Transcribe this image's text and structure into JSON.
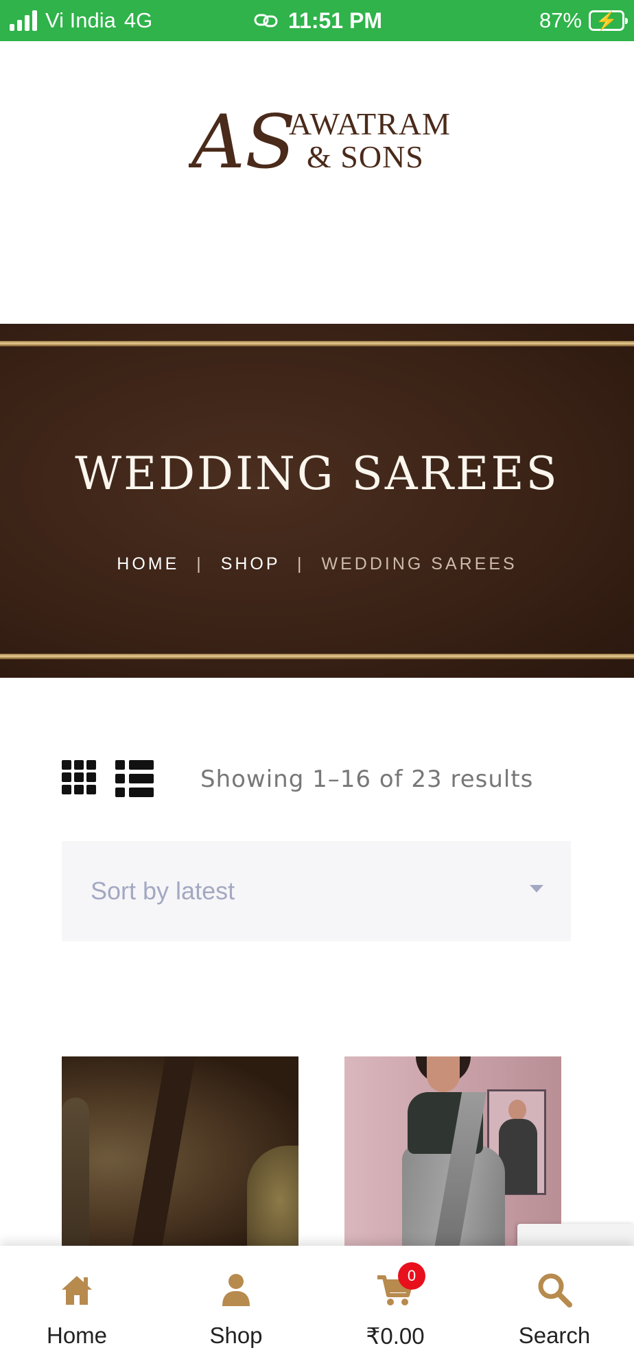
{
  "status_bar": {
    "carrier": "Vi India",
    "network": "4G",
    "time": "11:51 PM",
    "battery": "87%",
    "background_color": "#2fb34a"
  },
  "logo": {
    "monogram": "AS",
    "line1": "AWATRAM",
    "line2": "& SONS",
    "color": "#4a2a1a"
  },
  "banner": {
    "title": "WEDDING SAREES",
    "breadcrumb": {
      "home": "HOME",
      "separator": "|",
      "shop": "SHOP",
      "current": "WEDDING SAREES"
    }
  },
  "toolbar": {
    "grid_view_icon": "grid-icon",
    "list_view_icon": "list-icon",
    "result_count": "Showing 1–16 of 23 results",
    "sort": {
      "selected": "Sort by latest"
    }
  },
  "products": [
    {
      "image": "brown saree product photo"
    },
    {
      "image": "grey saree product photo"
    }
  ],
  "bottom_nav": {
    "accent_color": "#b78a4e",
    "items": [
      {
        "label": "Home",
        "icon": "home-icon"
      },
      {
        "label": "Shop",
        "icon": "user-icon"
      },
      {
        "label": "₹0.00",
        "icon": "cart-icon",
        "badge": "0"
      },
      {
        "label": "Search",
        "icon": "search-icon"
      }
    ]
  }
}
